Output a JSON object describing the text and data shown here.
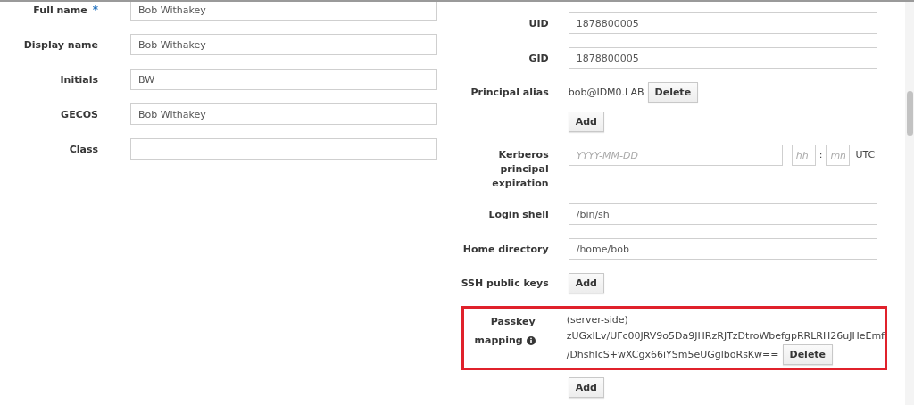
{
  "left_fields": [
    {
      "label": "Full name",
      "marker": "*",
      "value": "Bob Withakey"
    },
    {
      "label": "Display name",
      "value": "Bob Withakey"
    },
    {
      "label": "Initials",
      "value": "BW"
    },
    {
      "label": "GECOS",
      "value": "Bob Withakey"
    },
    {
      "label": "Class"
    }
  ],
  "right_fields": [
    {
      "kind": "text",
      "label": "UID",
      "value": "1878800005"
    },
    {
      "kind": "text",
      "label": "GID",
      "value": "1878800005"
    },
    {
      "kind": "multi",
      "label": "Principal alias",
      "items": [
        {
          "value": "bob@IDM0.LAB",
          "button": "Delete"
        }
      ],
      "add": "Add"
    },
    {
      "kind": "datetime",
      "label": "Kerberos principal expiration",
      "date_placeholder": "YYYY-MM-DD",
      "hour_placeholder": "hh",
      "separator": ":",
      "minute_placeholder": "mn",
      "zone": "UTC"
    },
    {
      "kind": "text",
      "label": "Login shell",
      "value": "/bin/sh"
    },
    {
      "kind": "text",
      "label": "Home directory",
      "value": "/home/bob"
    },
    {
      "kind": "multi",
      "label": "SSH public keys",
      "add": "Add"
    },
    {
      "kind": "multi",
      "label": "Passkey mapping",
      "info": true,
      "highlighted": true,
      "items": [
        {
          "lines": [
            "(server-side)",
            "zUGxILv/UFc00JRV9o5Da9JHRzRJTzDtroWbefgpRRLRH26uJHeEmf",
            "/DhshIcS+wXCgx66iYSm5eUGglboRsKw=="
          ],
          "button": "Delete"
        }
      ],
      "add": "Add"
    }
  ]
}
